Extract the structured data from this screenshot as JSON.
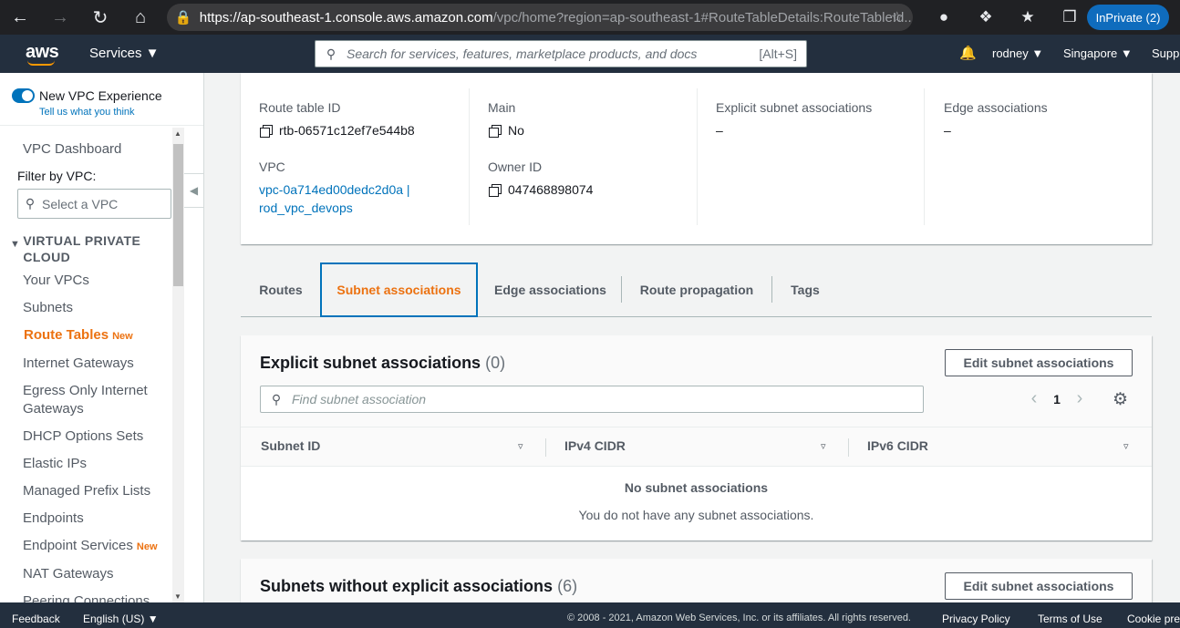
{
  "browser": {
    "url_host": "https://ap-southeast-1.console.aws.amazon.com",
    "url_rest": "/vpc/home?region=ap-southeast-1#RouteTableDetails:RouteTableId...",
    "inprivate_label": "InPrivate (2)"
  },
  "header": {
    "logo": "aws",
    "services_label": "Services ▼",
    "search_placeholder": "Search for services, features, marketplace products, and docs",
    "search_shortcut": "[Alt+S]",
    "user": "rodney ▼",
    "region": "Singapore ▼",
    "support": "Support"
  },
  "sidebar": {
    "experience_label": "New VPC Experience",
    "tell_us": "Tell us what you think",
    "dashboard": "VPC Dashboard",
    "filter_label": "Filter by VPC:",
    "filter_placeholder": "Select a VPC",
    "section_title": "VIRTUAL PRIVATE CLOUD",
    "items": [
      {
        "label": "Your VPCs",
        "badge": ""
      },
      {
        "label": "Subnets",
        "badge": ""
      },
      {
        "label": "Route Tables",
        "badge": "New"
      },
      {
        "label": "Internet Gateways",
        "badge": ""
      },
      {
        "label": "Egress Only Internet Gateways",
        "badge": ""
      },
      {
        "label": "DHCP Options Sets",
        "badge": ""
      },
      {
        "label": "Elastic IPs",
        "badge": ""
      },
      {
        "label": "Managed Prefix Lists",
        "badge": ""
      },
      {
        "label": "Endpoints",
        "badge": ""
      },
      {
        "label": "Endpoint Services",
        "badge": "New"
      },
      {
        "label": "NAT Gateways",
        "badge": ""
      },
      {
        "label": "Peering Connections",
        "badge": ""
      }
    ]
  },
  "details": {
    "route_table_id_label": "Route table ID",
    "route_table_id": "rtb-06571c12ef7e544b8",
    "vpc_label": "VPC",
    "vpc_value_line1": "vpc-0a714ed00dedc2d0a |",
    "vpc_value_line2": "rod_vpc_devops",
    "main_label": "Main",
    "main_value": "No",
    "owner_label": "Owner ID",
    "owner_value": "047468898074",
    "explicit_label": "Explicit subnet associations",
    "explicit_value": "–",
    "edge_label": "Edge associations",
    "edge_value": "–"
  },
  "tabs": [
    "Routes",
    "Subnet associations",
    "Edge associations",
    "Route propagation",
    "Tags"
  ],
  "explicit_card": {
    "title": "Explicit subnet associations",
    "count": "(0)",
    "edit_button": "Edit subnet associations",
    "find_placeholder": "Find subnet association",
    "page": "1",
    "columns": [
      "Subnet ID",
      "IPv4 CIDR",
      "IPv6 CIDR"
    ],
    "empty_title": "No subnet associations",
    "empty_desc": "You do not have any subnet associations."
  },
  "without_card": {
    "title": "Subnets without explicit associations",
    "count": "(6)",
    "edit_button": "Edit subnet associations"
  },
  "footer": {
    "feedback": "Feedback",
    "language": "English (US) ▼",
    "copyright": "© 2008 - 2021, Amazon Web Services, Inc. or its affiliates. All rights reserved.",
    "privacy": "Privacy Policy",
    "terms": "Terms of Use",
    "cookie": "Cookie preferences"
  },
  "colors": {
    "accent": "#ec7211",
    "link": "#0073bb",
    "header": "#232f3e"
  }
}
